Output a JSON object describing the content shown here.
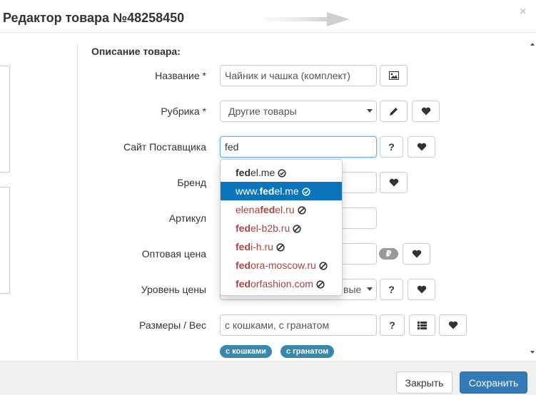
{
  "modal": {
    "title": "Редактор товара №48258450",
    "close_glyph": "×"
  },
  "section": {
    "title": "Описание товара:"
  },
  "fields": {
    "name": {
      "label": "Название *",
      "value": "Чайник и чашка (комплект)"
    },
    "category": {
      "label": "Рубрика *",
      "value": "Другие товары"
    },
    "supplier_site": {
      "label": "Сайт Поставщика",
      "value": "fed"
    },
    "brand": {
      "label": "Бренд"
    },
    "sku": {
      "label": "Артикул"
    },
    "wholesale_price": {
      "label": "Оптовая цена",
      "currency": "₽"
    },
    "price_level": {
      "label": "Уровень цены",
      "value_fragment": "вые"
    },
    "sizes": {
      "label": "Размеры / Вес",
      "value": "с кошками, с гранатом"
    }
  },
  "buttons": {
    "question": "?"
  },
  "tags": [
    "с кошками",
    "с гранатом"
  ],
  "suggestions": [
    {
      "match": "fed",
      "rest": "el.me",
      "prefix": "",
      "status": "ok",
      "active": false
    },
    {
      "match": "fed",
      "rest": "el.me",
      "prefix": "www.",
      "status": "ok",
      "active": true
    },
    {
      "match": "fed",
      "rest": "el.ru",
      "prefix": "elena",
      "status": "blocked",
      "active": false
    },
    {
      "match": "fed",
      "rest": "el-b2b.ru",
      "prefix": "",
      "status": "blocked",
      "active": false
    },
    {
      "match": "fed",
      "rest": "i-h.ru",
      "prefix": "",
      "status": "blocked",
      "active": false
    },
    {
      "match": "fed",
      "rest": "ora-moscow.ru",
      "prefix": "",
      "status": "blocked",
      "active": false
    },
    {
      "match": "fed",
      "rest": "orfashion.com",
      "prefix": "",
      "status": "blocked",
      "active": false
    }
  ],
  "footer": {
    "close_label": "Закрыть",
    "save_label": "Сохранить"
  },
  "colors": {
    "primary": "#337ab7",
    "active_item": "#0a75bd",
    "blocked": "#a94442",
    "tag": "#3a87ad"
  }
}
